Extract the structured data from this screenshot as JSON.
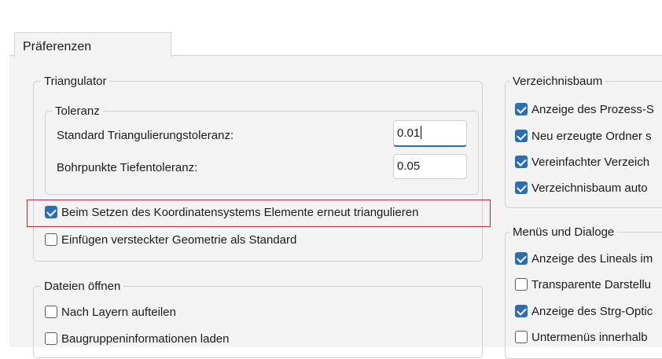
{
  "tab": {
    "label": "Präferenzen"
  },
  "triangulator": {
    "legend": "Triangulator",
    "toleranz": {
      "legend": "Toleranz",
      "std_label": "Standard Triangulierungstoleranz:",
      "std_value": "0.01",
      "bohr_label": "Bohrpunkte Tiefentoleranz:",
      "bohr_value": "0.05"
    },
    "checkboxes": [
      {
        "label": "Beim Setzen des Koordinatensystems Elemente erneut triangulieren",
        "checked": true
      },
      {
        "label": "Einfügen versteckter Geometrie als Standard",
        "checked": false
      }
    ]
  },
  "dateien": {
    "legend": "Dateien öffnen",
    "checkboxes": [
      {
        "label": "Nach Layern aufteilen",
        "checked": false
      },
      {
        "label": "Baugruppeninformationen laden",
        "checked": false
      }
    ]
  },
  "verzeichnisbaum": {
    "legend": "Verzeichnisbaum",
    "checkboxes": [
      {
        "label": "Anzeige des Prozess-S",
        "checked": true
      },
      {
        "label": "Neu erzeugte Ordner s",
        "checked": true
      },
      {
        "label": "Vereinfachter Verzeich",
        "checked": true
      },
      {
        "label": "Verzeichnisbaum auto",
        "checked": true
      }
    ]
  },
  "menues": {
    "legend": "Menüs und Dialoge",
    "checkboxes": [
      {
        "label": "Anzeige des Lineals im",
        "checked": true
      },
      {
        "label": "Transparente Darstellu",
        "checked": false
      },
      {
        "label": "Anzeige des Strg-Optic",
        "checked": true
      },
      {
        "label": "Untermenüs innerhalb",
        "checked": false
      }
    ]
  },
  "colors": {
    "accent": "#2a6fb6",
    "highlight": "#c8282d",
    "panel": "#f3f3f3"
  }
}
